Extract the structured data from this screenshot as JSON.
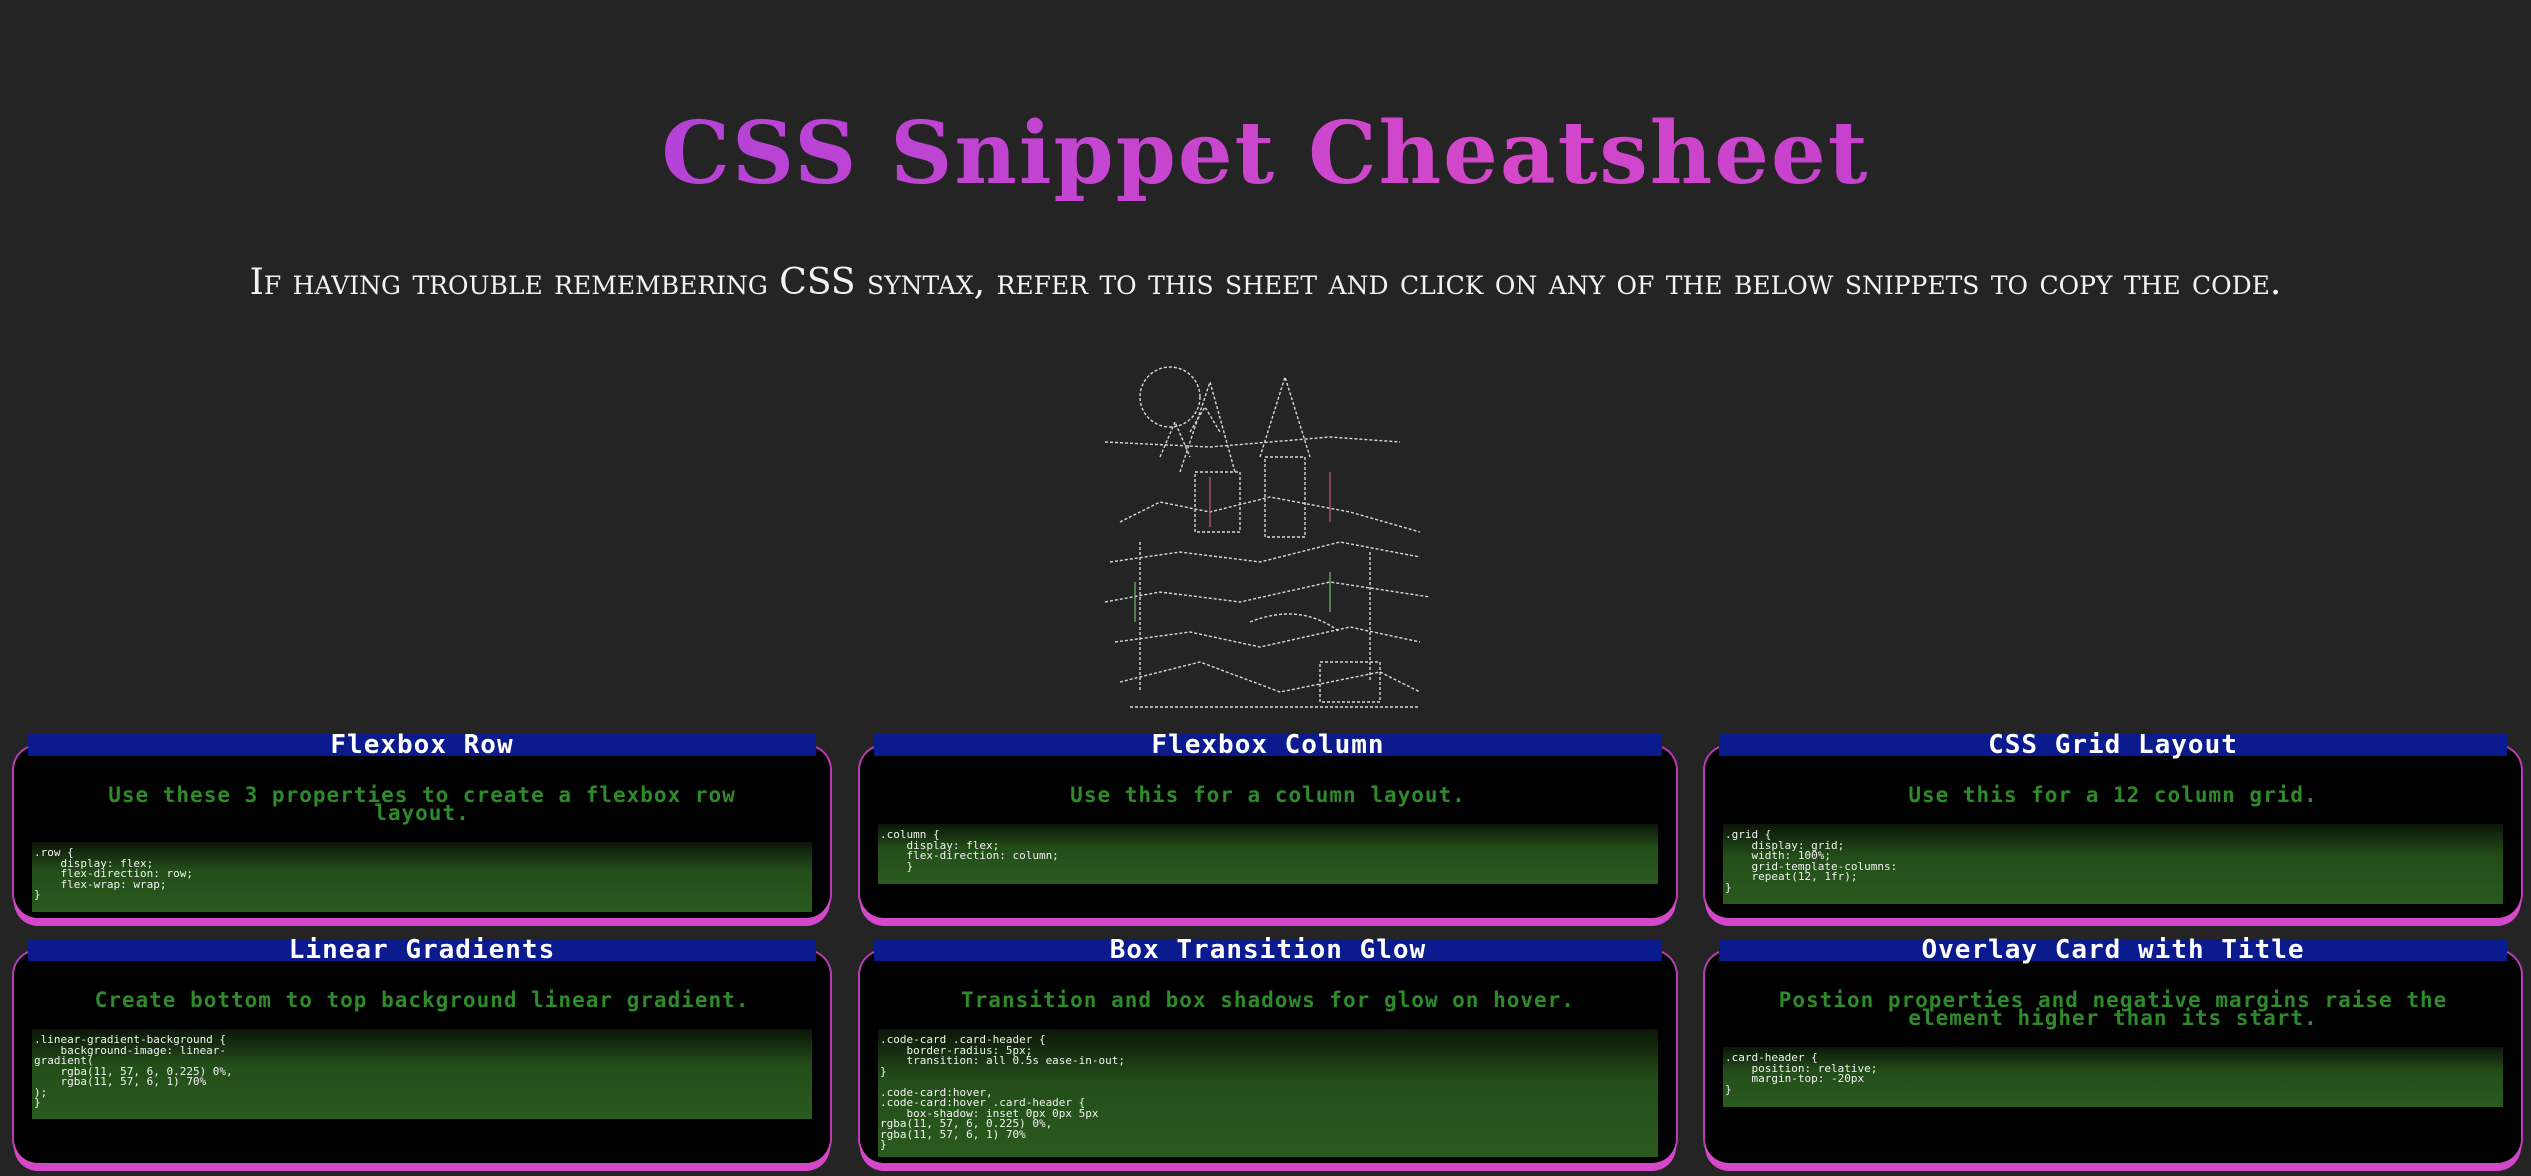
{
  "header": {
    "title": "CSS Snippet Cheatsheet",
    "subtitle": "If having trouble remembering CSS syntax, refer to this sheet and click on any of the below snippets to copy the code."
  },
  "colors": {
    "background": "#242424",
    "title_gradient_start": "#9b3fe0",
    "title_gradient_end": "#d447c9",
    "card_header": "#0b1a8c",
    "card_border": "#d447c9",
    "desc_text": "#2e8a2a",
    "code_bg": "#2a5a1e"
  },
  "cards": [
    {
      "title": "Flexbox Row",
      "description": "Use these 3 properties to create a flexbox row layout.",
      "code": ".row {\n    display: flex;\n    flex-direction: row;\n    flex-wrap: wrap;\n}"
    },
    {
      "title": "Flexbox Column",
      "description": "Use this for a column layout.",
      "code": ".column {\n    display: flex;\n    flex-direction: column;\n    }"
    },
    {
      "title": "CSS Grid Layout",
      "description": "Use this for a 12 column grid.",
      "code": ".grid {\n    display: grid;\n    width: 100%;\n    grid-template-columns:\n    repeat(12, 1fr);\n}"
    },
    {
      "title": "Linear Gradients",
      "description": "Create bottom to top background linear gradient.",
      "code": ".linear-gradient-background {\n    background-image: linear-\ngradient(\n    rgba(11, 57, 6, 0.225) 0%,\n    rgba(11, 57, 6, 1) 70%\n);\n}"
    },
    {
      "title": "Box Transition Glow",
      "description": "Transition and box shadows for glow on hover.",
      "code": ".code-card .card-header {\n    border-radius: 5px;\n    transition: all 0.5s ease-in-out;\n}\n\n.code-card:hover,\n.code-card:hover .card-header {\n    box-shadow: inset 0px 0px 5px\nrgba(11, 57, 6, 0.225) 0%,\nrgba(11, 57, 6, 1) 70%\n}"
    },
    {
      "title": "Overlay Card with Title",
      "description": "Postion properties and negative margins raise the element higher than its start.",
      "code": ".card-header {\n    position: relative;\n    margin-top: -20px\n}"
    }
  ]
}
